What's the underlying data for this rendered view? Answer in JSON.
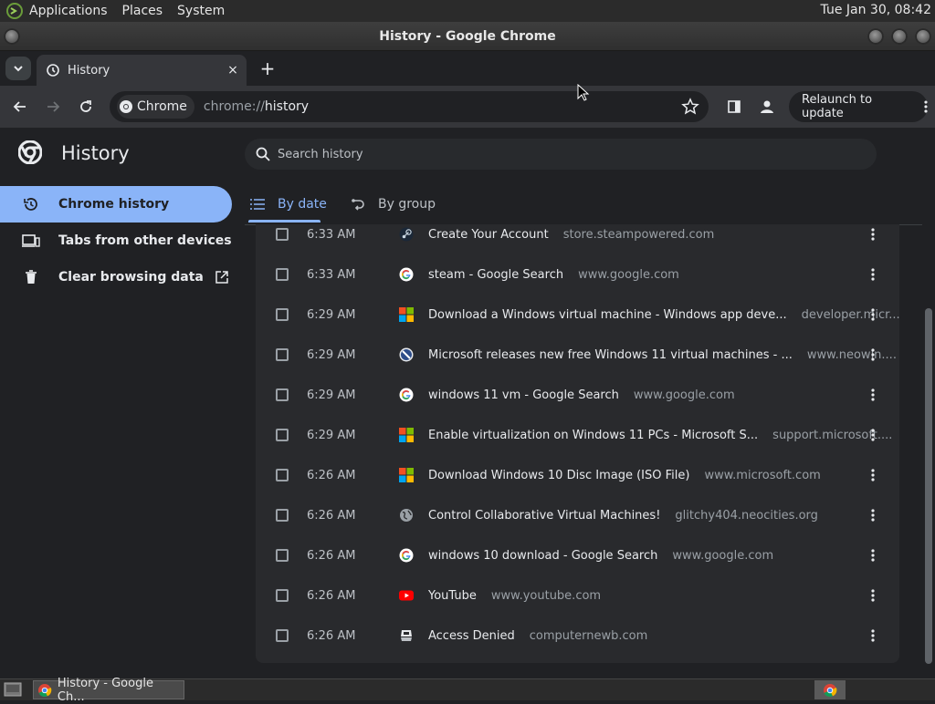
{
  "system_panel": {
    "menus": [
      "Applications",
      "Places",
      "System"
    ],
    "clock": "Tue Jan 30, 08:42"
  },
  "window": {
    "title": "History - Google Chrome"
  },
  "tab": {
    "label": "History",
    "close": "×",
    "new_tab": "+"
  },
  "omnibox": {
    "chip": "Chrome",
    "url_host": "chrome://",
    "url_path": "history"
  },
  "toolbar": {
    "relaunch_label": "Relaunch to update"
  },
  "page": {
    "title": "History",
    "search_placeholder": "Search history",
    "sidebar": [
      {
        "label": "Chrome history",
        "icon": "history-icon"
      },
      {
        "label": "Tabs from other devices",
        "icon": "devices-icon"
      },
      {
        "label": "Clear browsing data",
        "icon": "trash-icon"
      }
    ],
    "tabs": [
      {
        "label": "By date",
        "icon": "list-icon"
      },
      {
        "label": "By group",
        "icon": "group-icon"
      }
    ]
  },
  "history": [
    {
      "time": "6:33 AM",
      "title": "Create Your Account",
      "domain": "store.steampowered.com",
      "favicon": "steam"
    },
    {
      "time": "6:33 AM",
      "title": "steam - Google Search",
      "domain": "www.google.com",
      "favicon": "google"
    },
    {
      "time": "6:29 AM",
      "title": "Download a Windows virtual machine - Windows app deve...",
      "domain": "developer.micr...",
      "favicon": "microsoft"
    },
    {
      "time": "6:29 AM",
      "title": "Microsoft releases new free Windows 11 virtual machines - ...",
      "domain": "www.neowin....",
      "favicon": "neowin"
    },
    {
      "time": "6:29 AM",
      "title": "windows 11 vm - Google Search",
      "domain": "www.google.com",
      "favicon": "google"
    },
    {
      "time": "6:29 AM",
      "title": "Enable virtualization on Windows 11 PCs - Microsoft S...",
      "domain": "support.microsoft....",
      "favicon": "microsoft"
    },
    {
      "time": "6:26 AM",
      "title": "Download Windows 10 Disc Image (ISO File)",
      "domain": "www.microsoft.com",
      "favicon": "microsoft"
    },
    {
      "time": "6:26 AM",
      "title": "Control Collaborative Virtual Machines!",
      "domain": "glitchy404.neocities.org",
      "favicon": "globe"
    },
    {
      "time": "6:26 AM",
      "title": "windows 10 download - Google Search",
      "domain": "www.google.com",
      "favicon": "google"
    },
    {
      "time": "6:26 AM",
      "title": "YouTube",
      "domain": "www.youtube.com",
      "favicon": "youtube"
    },
    {
      "time": "6:26 AM",
      "title": "Access Denied",
      "domain": "computernewb.com",
      "favicon": "computernewb"
    }
  ],
  "taskbar": {
    "item_label": "History - Google Ch..."
  },
  "colors": {
    "accent": "#8ab4f8",
    "background": "#202124",
    "card": "#292a2d"
  }
}
